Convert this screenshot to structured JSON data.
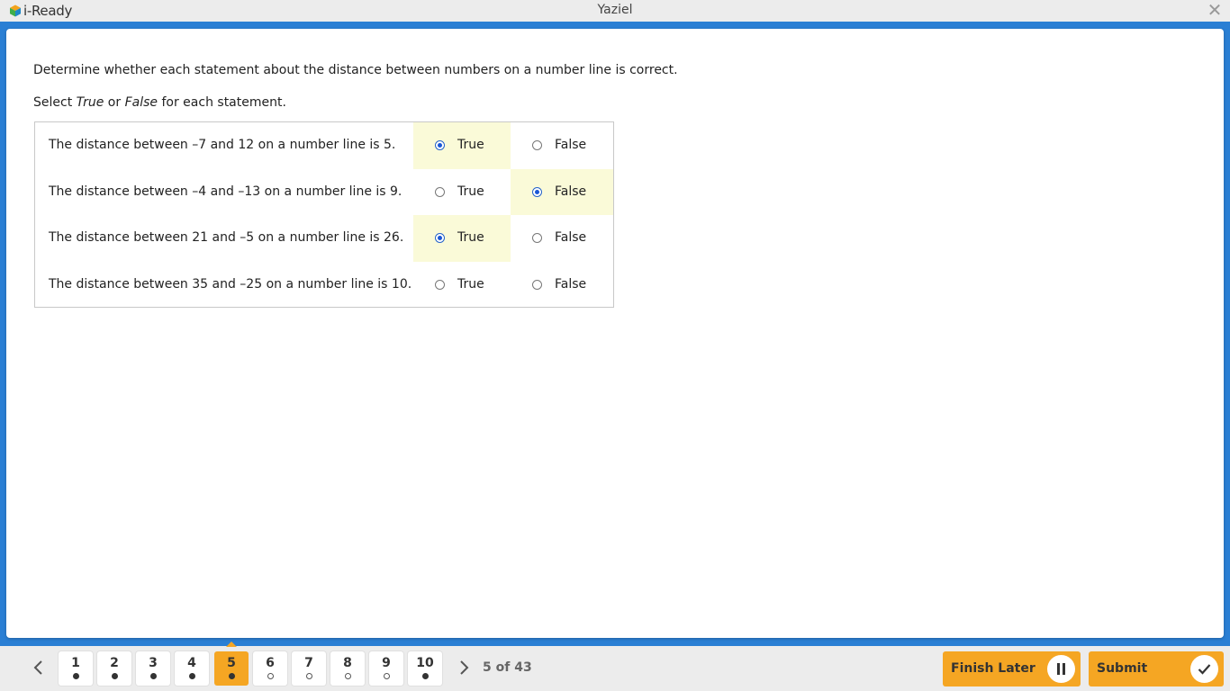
{
  "app": {
    "logo_text": "i-Ready",
    "window_title": "Yaziel",
    "close_glyph": "✕",
    "icons": [
      "iready-cube-icon",
      "close-icon"
    ]
  },
  "question": {
    "instruction": "Determine whether each statement about the distance between numbers on a number line is correct.",
    "select_prefix": "Select ",
    "select_true": "True",
    "select_or": " or ",
    "select_false": "False",
    "select_suffix": " for each statement.",
    "option_true_label": "True",
    "option_false_label": "False",
    "statements": [
      {
        "text": "The distance between –7 and 12 on a number line is 5.",
        "selected": "True"
      },
      {
        "text": "The distance between –4 and –13 on a number line is 9.",
        "selected": "False"
      },
      {
        "text": "The distance between 21 and –5 on a number line is 26.",
        "selected": "True"
      },
      {
        "text": "The distance between 35 and –25 on a number line is 10.",
        "selected": null
      }
    ],
    "selection_highlight_color": "#fafad8",
    "radio_color": "#1a56d6"
  },
  "footer": {
    "questions": [
      {
        "label": "1",
        "answered": true
      },
      {
        "label": "2",
        "answered": true
      },
      {
        "label": "3",
        "answered": true
      },
      {
        "label": "4",
        "answered": true
      },
      {
        "label": "5",
        "answered": true,
        "current": true
      },
      {
        "label": "6",
        "answered": false
      },
      {
        "label": "7",
        "answered": false
      },
      {
        "label": "8",
        "answered": false
      },
      {
        "label": "9",
        "answered": false
      },
      {
        "label": "10",
        "answered": true
      }
    ],
    "progress": "5 of 43",
    "finish_later_label": "Finish Later",
    "submit_label": "Submit",
    "accent_color": "#f5a623",
    "icons": [
      "chevron-left-icon",
      "chevron-right-icon",
      "pause-icon",
      "check-icon"
    ]
  }
}
